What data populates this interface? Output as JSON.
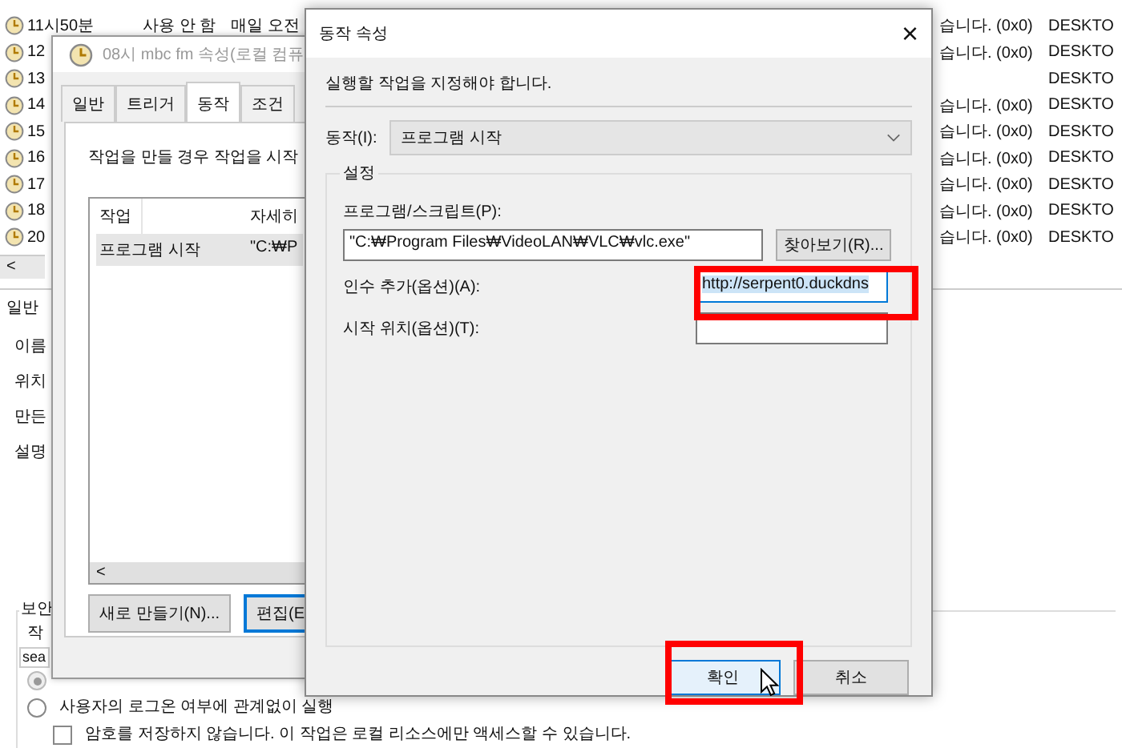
{
  "task_list": {
    "rows": [
      {
        "name": "11시50분",
        "status": "사용 안 함",
        "trigger": "매일 오전",
        "result": "습니다. (0x0)",
        "author": "DESKTO"
      },
      {
        "name": "12",
        "result": "습니다. (0x0)",
        "author": "DESKTO"
      },
      {
        "name": "13",
        "author": "DESKTO"
      },
      {
        "name": "14",
        "result": "습니다. (0x0)",
        "author": "DESKTO"
      },
      {
        "name": "15",
        "result": "습니다. (0x0)",
        "author": "DESKTO"
      },
      {
        "name": "16",
        "result": "습니다. (0x0)",
        "author": "DESKTO"
      },
      {
        "name": "17",
        "result": "습니다. (0x0)",
        "author": "DESKTO"
      },
      {
        "name": "18",
        "result": "습니다. (0x0)",
        "author": "DESKTO"
      },
      {
        "name": "20",
        "result": "습니다. (0x0)",
        "author": "DESKTO"
      }
    ],
    "scroll_arrow": "<"
  },
  "detail_pane": {
    "tab": "일반",
    "labels": [
      "이름",
      "위치",
      "만든",
      "설명"
    ],
    "security": {
      "title": "보안",
      "label": "작",
      "account": "sea",
      "options": [
        {
          "kind": "radio",
          "selected": true,
          "disabled": true
        },
        {
          "kind": "radio",
          "selected": false,
          "disabled": false,
          "label": "사용자의 로그온 여부에 관계없이 실행"
        },
        {
          "kind": "checkbox",
          "checked": false,
          "label": "암호를 저장하지 않습니다. 이 작업은 로컬 리소스에만 액세스할 수 있습니다."
        }
      ]
    }
  },
  "properties_window": {
    "title": "08시 mbc fm 속성(로컬 컴퓨",
    "tabs": [
      {
        "label": "일반",
        "selected": false
      },
      {
        "label": "트리거",
        "selected": false
      },
      {
        "label": "동작",
        "selected": true
      },
      {
        "label": "조건",
        "selected": false
      }
    ],
    "description": "작업을 만들 경우 작업을 시작",
    "columns": [
      "작업",
      "자세히"
    ],
    "rows": [
      {
        "action": "프로그램 시작",
        "details": "\"C:₩P"
      }
    ],
    "scroll_arrow": "<",
    "buttons": [
      {
        "label": "새로 만들기(N)...",
        "focused": false
      },
      {
        "label": "편집(E",
        "focused": true
      }
    ]
  },
  "action_dialog": {
    "title": "동작 속성",
    "close": "×",
    "instruction": "실행할 작업을 지정해야 합니다.",
    "action_label": "동작(I):",
    "action_value": "프로그램 시작",
    "group": "설정",
    "program_label": "프로그램/스크립트(P):",
    "program_value": "\"C:₩Program Files₩VideoLAN₩VLC₩vlc.exe\"",
    "browse": "찾아보기(R)...",
    "arguments_label": "인수 추가(옵션)(A):",
    "arguments_value": "http://serpent0.duckdns",
    "arguments_selected": true,
    "start_label": "시작 위치(옵션)(T):",
    "buttons": [
      {
        "label": "확인",
        "default": true
      },
      {
        "label": "취소",
        "default": false
      }
    ]
  }
}
